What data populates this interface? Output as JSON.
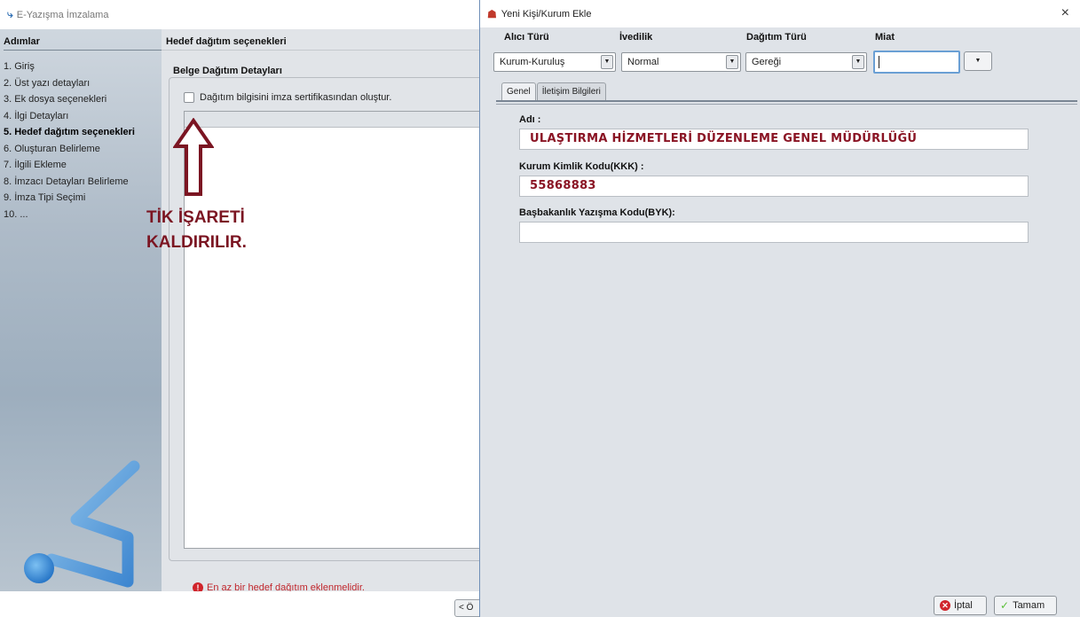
{
  "main_window": {
    "title": "E-Yazışma İmzalama",
    "steps_title": "Adımlar",
    "steps": [
      {
        "label": "1. Giriş"
      },
      {
        "label": "2. Üst yazı detayları"
      },
      {
        "label": "3. Ek dosya seçenekleri"
      },
      {
        "label": "4. İlgi Detayları"
      },
      {
        "label": "5. Hedef dağıtım seçenekleri",
        "active": true
      },
      {
        "label": "6. Oluşturan Belirleme"
      },
      {
        "label": "7. İlgili Ekleme"
      },
      {
        "label": "8. İmzacı Detayları Belirleme"
      },
      {
        "label": "9. İmza Tipi Seçimi"
      },
      {
        "label": "10. ..."
      }
    ],
    "section_title": "Hedef dağıtım seçenekleri",
    "frame_title": "Belge Dağıtım Detayları",
    "cert_checkbox_label": "Dağıtım bilgisini imza sertifikasından oluştur.",
    "error_message": "En az bir hedef dağıtım eklenmelidir.",
    "prev_button": "< Ö"
  },
  "annotation": {
    "line1": "TİK İŞARETİ",
    "line2": "KALDIRILIR.",
    "color": "#7b1522"
  },
  "dialog": {
    "title": "Yeni Kişi/Kurum Ekle",
    "close_glyph": "×",
    "alici_turu_label": "Alıcı Türü",
    "alici_turu_value": "Kurum-Kuruluş",
    "ivedilik_label": "İvedilik",
    "ivedilik_value": "Normal",
    "dagitim_turu_label": "Dağıtım Türü",
    "dagitim_turu_value": "Gereği",
    "miat_label": "Miat",
    "miat_value": "",
    "tabs": [
      {
        "label": "Genel",
        "selected": true
      },
      {
        "label": "İletişim Bilgileri",
        "selected": false
      }
    ],
    "adi_label": "Adı :",
    "adi_value": "ULAŞTIRMA HİZMETLERİ DÜZENLEME GENEL MÜDÜRLÜĞÜ",
    "kkk_label": "Kurum Kimlik Kodu(KKK) :",
    "kkk_value": "55868883",
    "byk_label": "Başbakanlık Yazışma Kodu(BYK):",
    "byk_value": "",
    "cancel_button": "İptal",
    "ok_button": "Tamam"
  },
  "icons": {
    "app": "signature-icon",
    "dialog": "people-add-icon",
    "error": "error-circle-icon",
    "cancel": "cancel-circle-icon",
    "ok": "checkmark-icon",
    "arrow": "up-arrow-annotation"
  }
}
